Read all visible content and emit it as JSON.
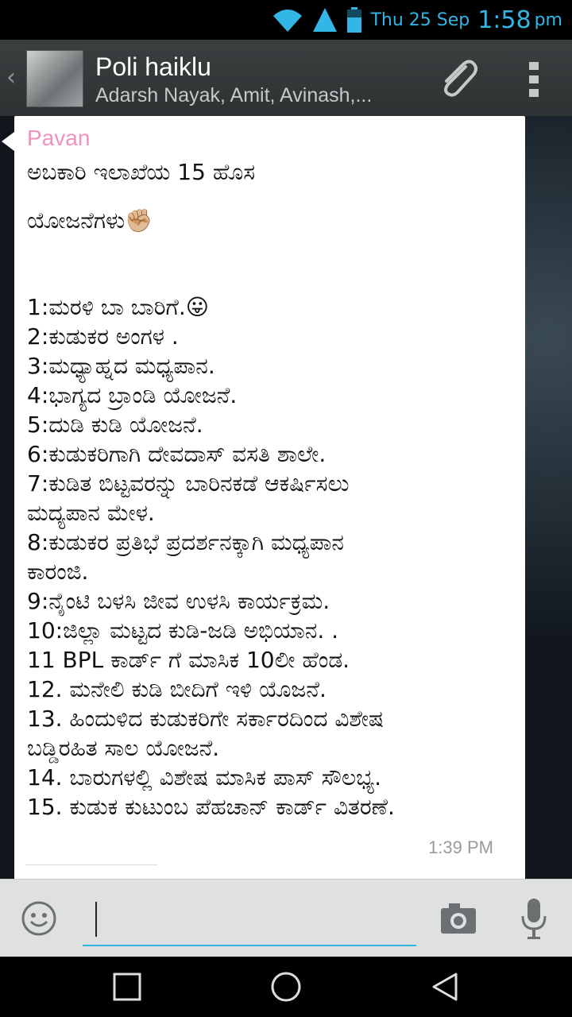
{
  "status": {
    "date": "Thu 25 Sep",
    "time": "1:58",
    "ampm": "pm",
    "icons": [
      "wifi-icon",
      "signal-icon",
      "battery-icon"
    ]
  },
  "header": {
    "title": "Poli haiklu",
    "subtitle": "Adarsh Nayak, Amit, Avinash,..."
  },
  "message": {
    "sender": "Pavan",
    "time": "1:39 PM",
    "lines": {
      "l0": "ಅಬಕಾರಿ ಇಲಾಖೆಯ 15 ಹೊಸ",
      "l1": "ಯೋಜನೆಗಳು✊🏼",
      "l2": "1:ಮರಳಿ ಬಾ ಬಾರಿಗೆ.😛",
      "l3": "2:ಕುಡುಕರ ಅಂಗಳ .",
      "l4": "3:ಮಧ್ಯಾಹ್ನದ ಮಧ್ಯಪಾನ.",
      "l5": "4:ಭಾಗ್ಯದ ಬ್ರಾಂಡಿ ಯೋಜನೆ.",
      "l6": "5:ದುಡಿ ಕುಡಿ ಯೋಜನೆ.",
      "l7": "6:ಕುಡುಕರಿಗಾಗಿ ದೇವದಾಸ್ ವಸತಿ ಶಾಲೇ.",
      "l8": "7:ಕುಡಿತ ಬಿಟ್ಟವರನ್ನು ಬಾರಿನಕಡೆ ಆಕರ್ಷಿಸಲು",
      "l9": "ಮದ್ಯಪಾನ ಮೇಳ.",
      "l10": "8:ಕುಡುಕರ ಪ್ರತಿಭೆ ಪ್ರದರ್ಶನಕ್ಕಾಗಿ ಮಧ್ಯಪಾನ",
      "l11": "ಕಾರಂಜಿ.",
      "l12": "9:ನೈಂಟಿ ಬಳಸಿ ಜೀವ ಉಳಸಿ ಕಾರ್ಯಕ್ರಮ.",
      "l13": "10:ಜಿಲ್ಲಾ ಮಟ್ಟದ ಕುಡಿ-ಜಡಿ ಅಭಿಯಾನ. .",
      "l14": "11 BPL  ಕಾರ್ಡ್ ಗೆ ಮಾಸಿಕ 10ಲೀ ಹೆಂಡ.",
      "l15": "12. ಮನೇಲಿ ಕುಡಿ ಬೀದಿಗೆ ಇಳಿ ಯೊಜನೆ.",
      "l16": "13. ಹಿಂದುಳಿದ ಕುಡುಕರಿಗೇ ಸರ್ಕಾರದಿಂದ ವಿಶೇಷ",
      "l17": "ಬಡ್ಡಿರಹಿತ ಸಾಲ ಯೋಜನೆ.",
      "l18": "14. ಬಾರುಗಳಲ್ಲಿ ವಿಶೇಷ ಮಾಸಿಕ ಪಾಸ್ ಸೌಲಭ್ಯ.",
      "l19": "15. ಕುಡುಕ ಕುಟುಂಬ ಪೆಹಚಾನ್ ಕಾರ್ಡ್ ವಿತರಣೆ."
    }
  },
  "input": {
    "placeholder": ""
  },
  "colors": {
    "accent": "#33b5e5",
    "sender": "#f092be",
    "actionbar": "#353a3b"
  }
}
